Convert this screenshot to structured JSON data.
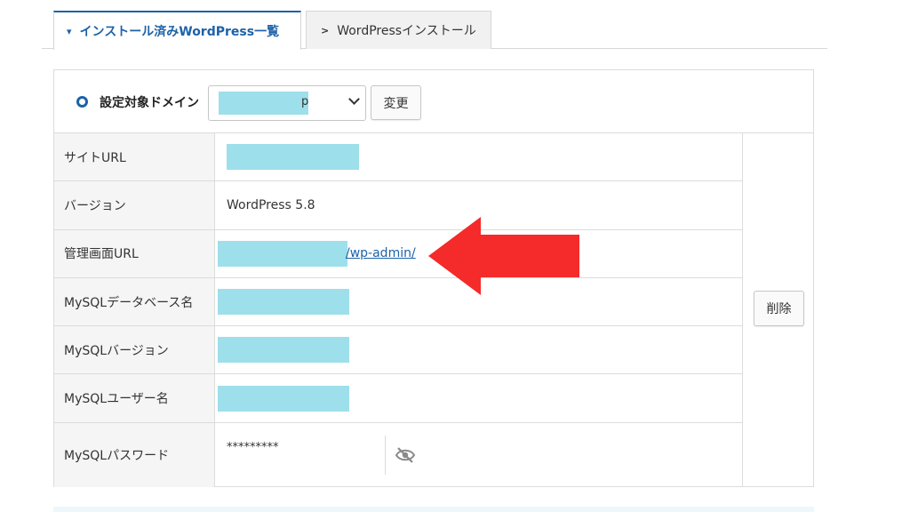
{
  "tabs": {
    "installed": "インストール済みWordPress一覧",
    "install": "WordPressインストール"
  },
  "domain": {
    "label": "設定対象ドメイン",
    "selected_tail": "p",
    "change_button": "変更"
  },
  "rows": [
    {
      "label": "サイトURL",
      "value": ""
    },
    {
      "label": "バージョン",
      "value": "WordPress 5.8"
    },
    {
      "label": "管理画面URL",
      "value": "/wp-admin/"
    },
    {
      "label": "MySQLデータベース名",
      "value": ""
    },
    {
      "label": "MySQLバージョン",
      "value": ""
    },
    {
      "label": "MySQLユーザー名",
      "value": ""
    },
    {
      "label": "MySQLパスワード",
      "value": "*********"
    }
  ],
  "delete_button": "削除",
  "colors": {
    "accent": "#1d62a8",
    "redaction": "#9ddfea",
    "arrow": "#f52a2a"
  },
  "icons": {
    "tab_active": "chevron-down-icon",
    "tab_inactive": "chevron-right-icon",
    "password_toggle": "eye-slash-icon",
    "annotation": "red-arrow-left"
  }
}
